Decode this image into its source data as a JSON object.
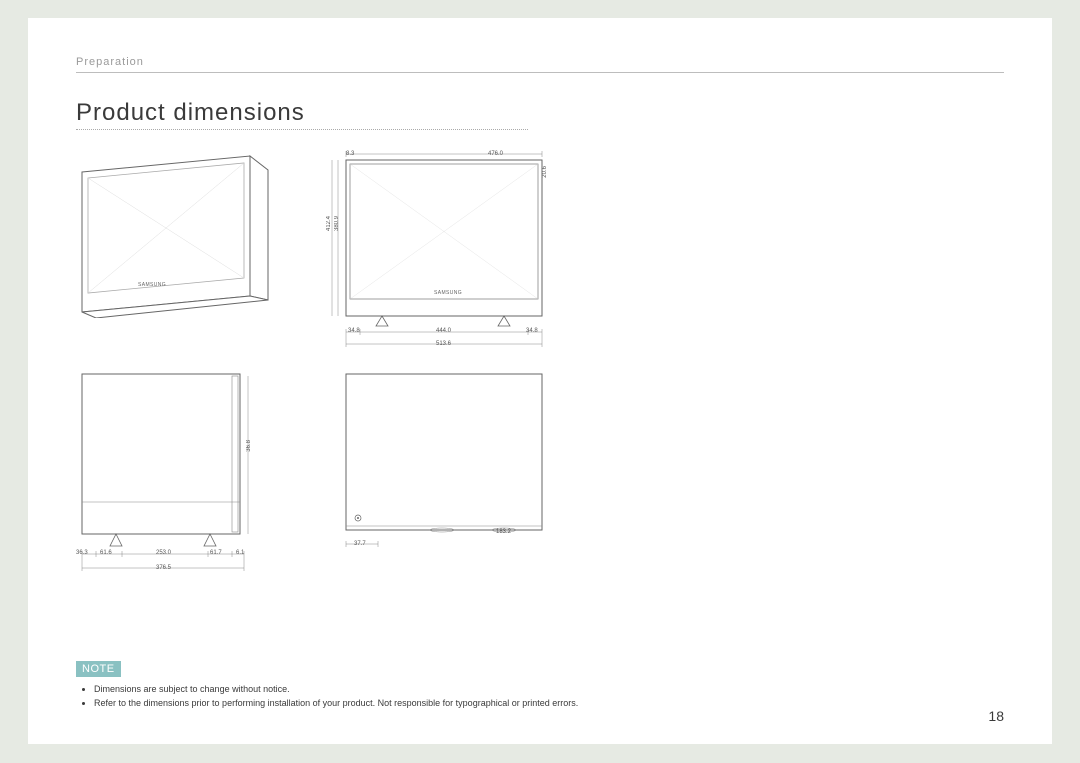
{
  "section": "Preparation",
  "title": "Product dimensions",
  "brand": "SAMSUNG",
  "dims": {
    "front_top": "476.0",
    "front_top_small": "8.3",
    "front_right_v": "20.6",
    "front_left_v1": "412.4",
    "front_left_v2": "380.9",
    "front_bot_left": "34.8",
    "front_bot_center": "444.0",
    "front_bot_right": "34.8",
    "front_total": "513.6",
    "side_v": "36.8",
    "side_b1": "36.3",
    "side_b2": "61.6",
    "side_b3": "253.0",
    "side_b4": "61.7",
    "side_b5": "6.1",
    "side_total": "376.5",
    "top_b1": "37.7",
    "top_b2": "183.2"
  },
  "note": {
    "label": "NOTE",
    "items": [
      "Dimensions are subject to change without notice.",
      "Refer to the dimensions prior to performing installation of your product. Not responsible for typographical or printed errors."
    ]
  },
  "page_number": "18"
}
